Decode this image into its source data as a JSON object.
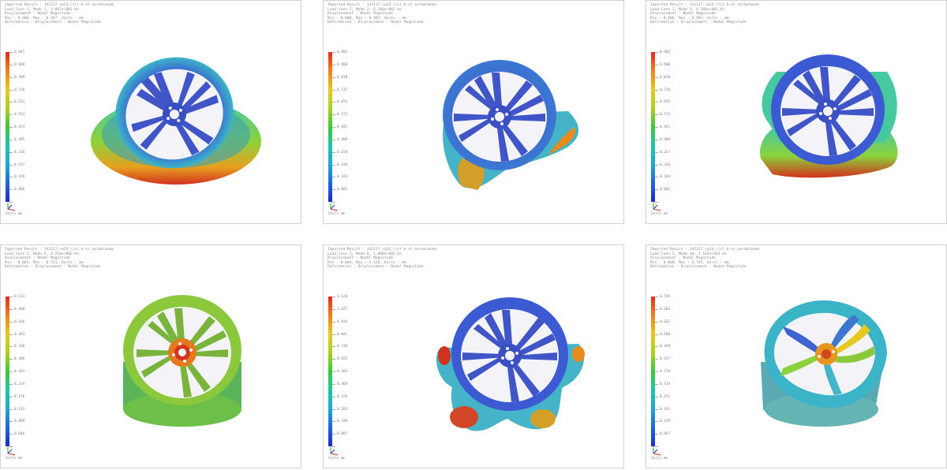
{
  "panels": [
    {
      "header": [
        "Imported Result : 142117_rw24_ricl_b-el_normalmode",
        "Load Case 1, Mode 1, 3.067e+002 Hz",
        "Displacement : Nodal Magnitude",
        "Min : 0.000, Max : 0.947, Units : mm",
        "Deformation : Displacement : Nodal Magnitude"
      ],
      "ticks": [
        "0.947",
        "0.868",
        "0.789",
        "0.710",
        "0.631",
        "0.553",
        "0.474",
        "0.395",
        "0.316",
        "0.237",
        "0.158",
        "0.080",
        ""
      ],
      "units": "Units mm"
    },
    {
      "header": [
        "Imported Result : 142117_rw24_ricl_b-el_normalmode",
        "Load Case 1, Mode 2, 6.260e+002 Hz",
        "Displacement : Nodal Magnitude",
        "Min : 0.000, Max : 0.982, Units : mm",
        "Deformation : Displacement : Nodal Magnitude"
      ],
      "ticks": [
        "0.982",
        "0.900",
        "0.818",
        "0.737",
        "0.655",
        "0.573",
        "0.491",
        "0.409",
        "0.328",
        "0.246",
        "0.164",
        "0.082",
        ""
      ],
      "units": "Units mm"
    },
    {
      "header": [
        "Imported Result : 142117_rw24_ricl_b-el_normalmode",
        "Load Case 1, Mode 3, 6.260e+002 Hz",
        "Displacement : Nodal Magnitude",
        "Min : 0.000, Max : 0.982, Units : mm",
        "Deformation : Displacement : Nodal Magnitude"
      ],
      "ticks": [
        "0.982",
        "0.900",
        "0.818",
        "0.736",
        "0.655",
        "0.573",
        "0.491",
        "0.409",
        "0.327",
        "0.246",
        "0.164",
        "0.082",
        ""
      ],
      "units": "Units mm"
    },
    {
      "header": [
        "Imported Result : 142117_rw24_ricl_b-el_normalmode",
        "Load Case 1, Mode 5, 8.256e+002 Hz",
        "Displacement : Nodal Magnitude",
        "Min : 0.003, Max : 0.523, Units : mm",
        "Deformation : Displacement : Nodal Magnitude"
      ],
      "ticks": [
        "0.523",
        "0.480",
        "0.436",
        "0.393",
        "0.350",
        "0.306",
        "0.263",
        "0.219",
        "0.176",
        "0.133",
        "0.089",
        "0.046",
        ""
      ],
      "units": "Units mm"
    },
    {
      "header": [
        "Imported Result : 142117_rw24_ricl_b-el_normalmode",
        "Load Case 1, Mode 8, 1.090e+003 Hz",
        "Displacement : Nodal Magnitude",
        "Min : 0.004, Max : 1.120, Units : mm",
        "Deformation : Displacement : Nodal Magnitude"
      ],
      "ticks": [
        "1.120",
        "1.027",
        "0.934",
        "0.841",
        "0.748",
        "0.655",
        "0.562",
        "0.469",
        "0.376",
        "0.283",
        "0.190",
        "0.097",
        ""
      ],
      "units": "Units mm"
    },
    {
      "header": [
        "Imported Result : 142117_rw24_ricl_b-el_normalmode",
        "Load Case 1, Mode 10, 1.526e+003 Hz",
        "Displacement : Nodal Magnitude",
        "Min : 0.008, Max : 0.745, Units : mm",
        "Deformation : Displacement : Nodal Magnitude"
      ],
      "ticks": [
        "0.745",
        "0.683",
        "0.622",
        "0.560",
        "0.499",
        "0.437",
        "0.376",
        "0.314",
        "0.252",
        "0.191",
        "0.129",
        "0.067",
        ""
      ],
      "units": "Units mm"
    }
  ]
}
